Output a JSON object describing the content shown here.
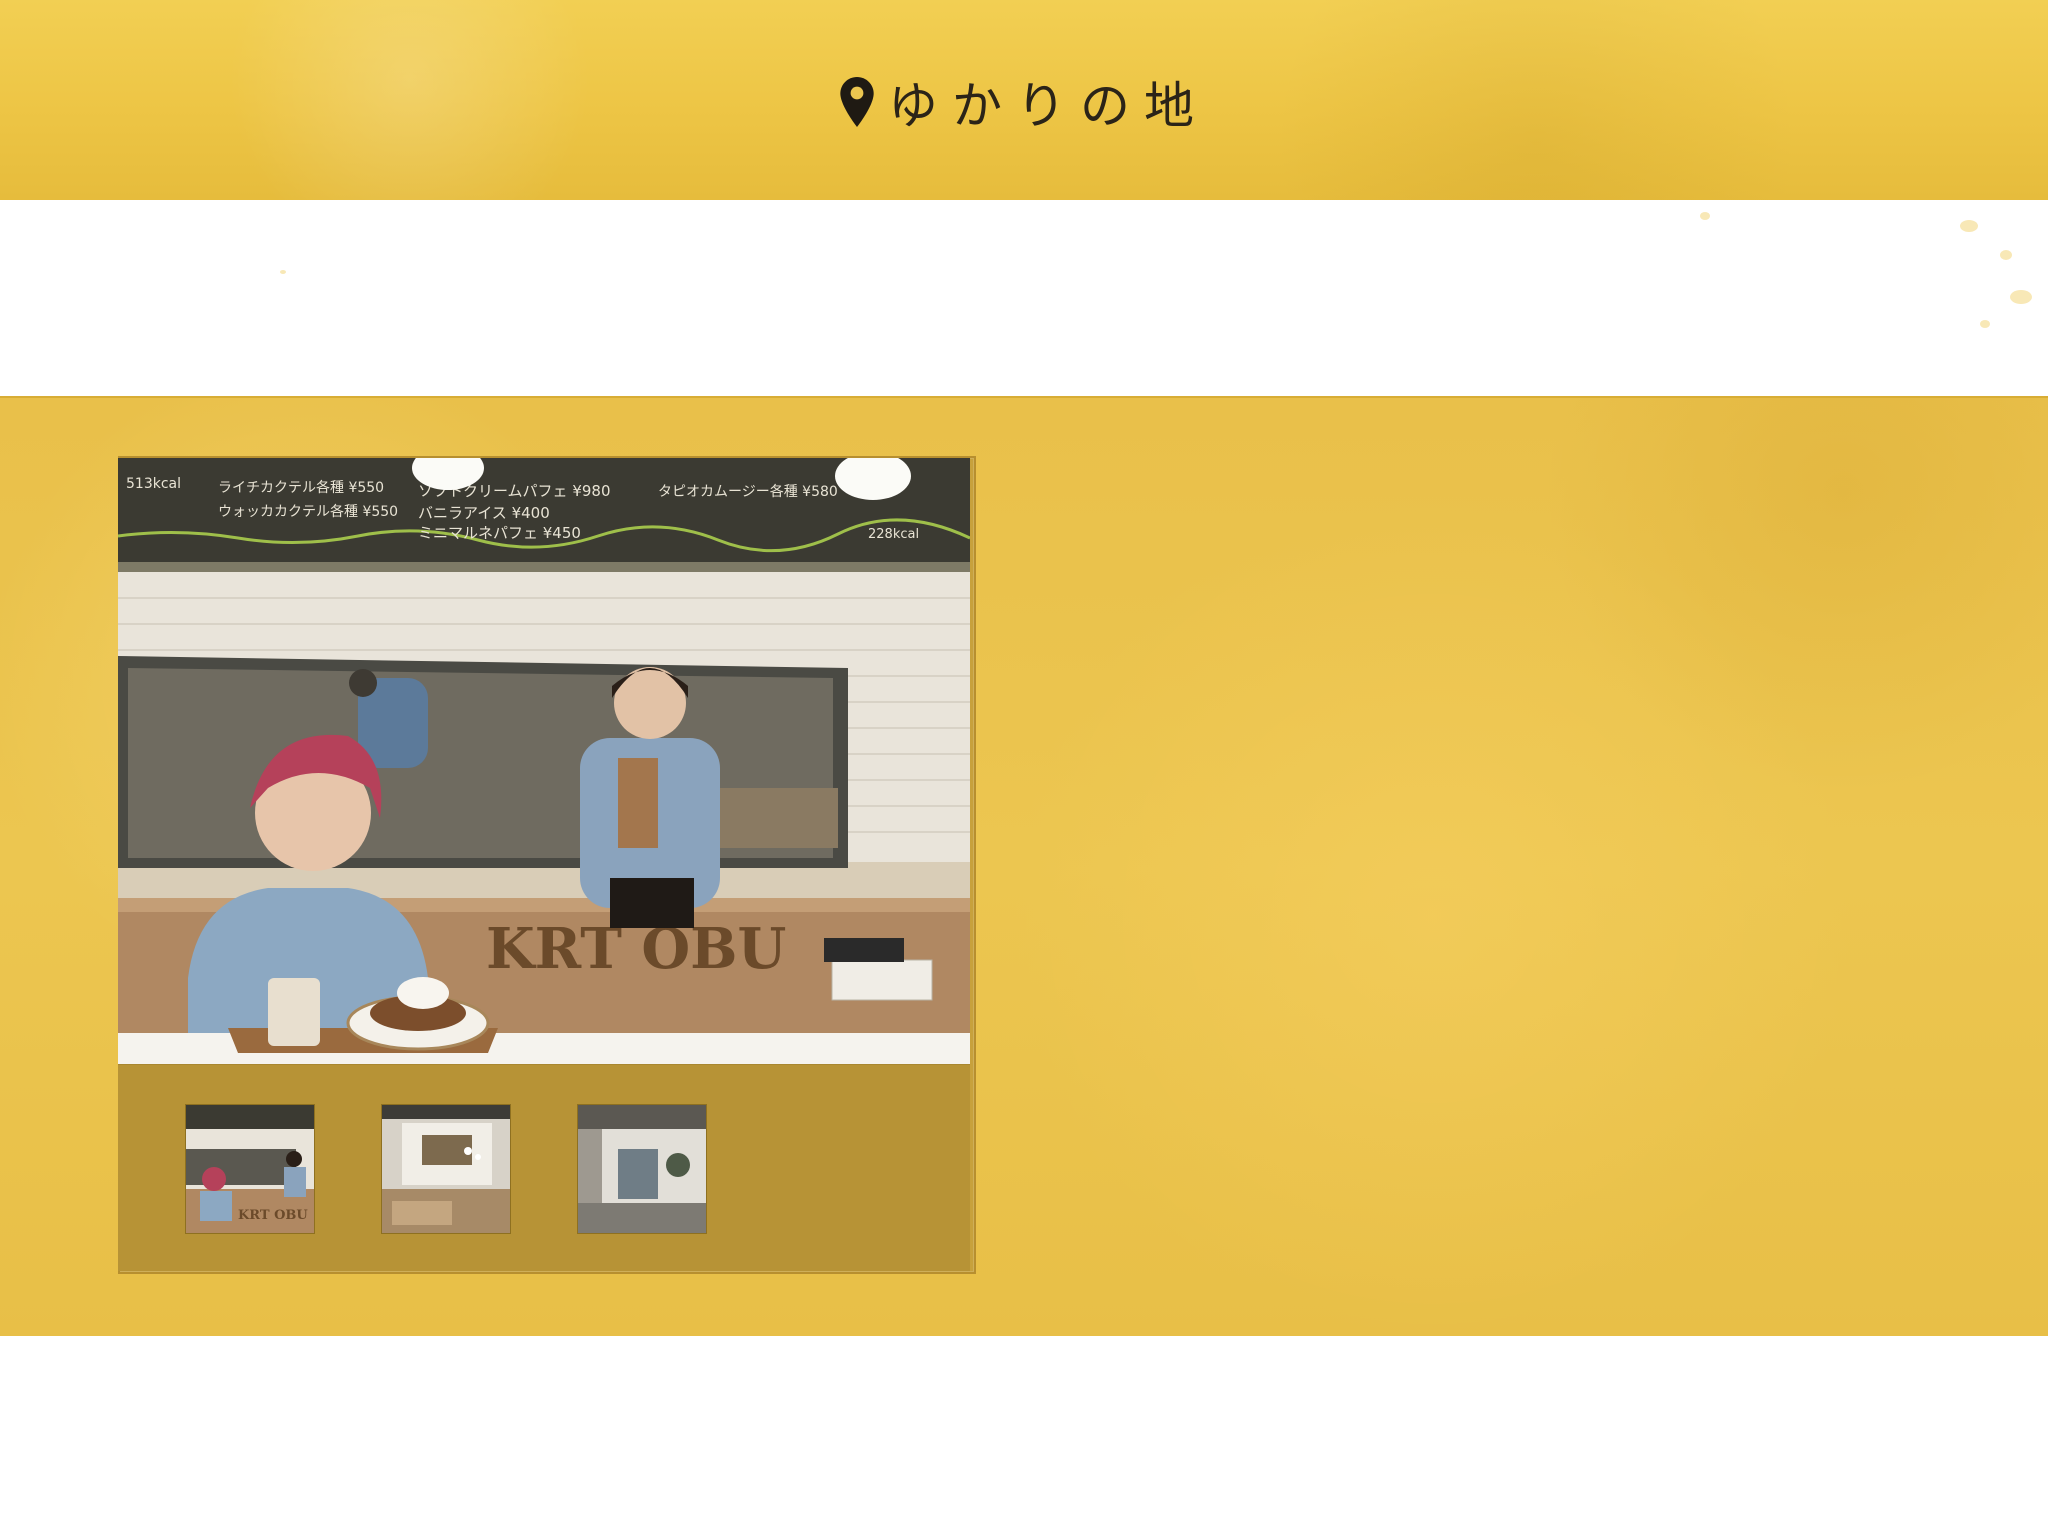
{
  "header": {
    "title": "ゆかりの地",
    "icon": "map-pin-icon"
  },
  "gallery": {
    "main_photo": {
      "sign_text": "KRT OBU",
      "menu_board": [
        "ライチカクテル各種 ¥550",
        "ウォッカカクテル各種 ¥550",
        "バニラアイス ¥400",
        "ミニマルネパフェ ¥450",
        "ソフトクリームパフェ ¥980",
        "タピオカムージー各種 ¥580",
        "513kcal",
        "228kcal"
      ]
    },
    "thumbnails": [
      {
        "name": "thumb-cafe-staff",
        "selected": true
      },
      {
        "name": "thumb-cafe-interior",
        "selected": false
      },
      {
        "name": "thumb-building-exterior",
        "selected": false
      }
    ]
  },
  "colors": {
    "band_yellow": "#ecc650",
    "frame_gold": "#c7a13c",
    "strip_gold": "#b79336"
  }
}
